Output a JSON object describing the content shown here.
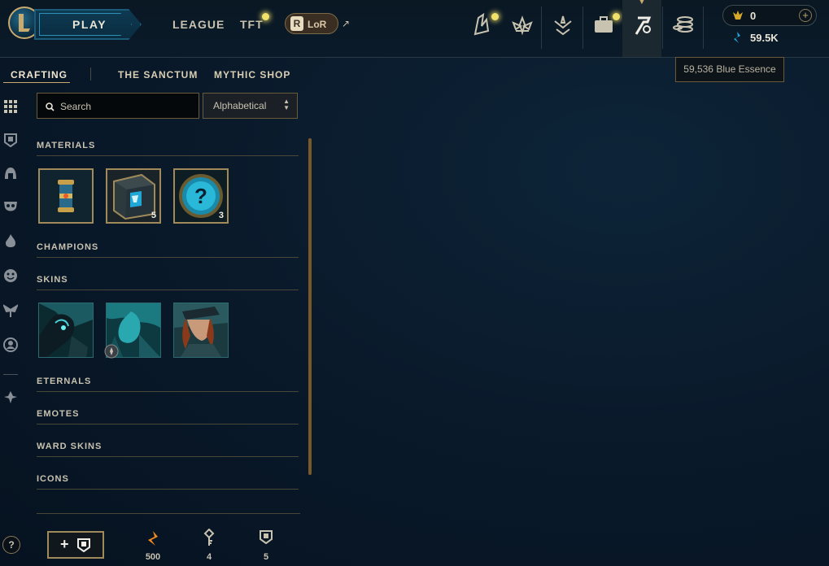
{
  "topbar": {
    "play_label": "PLAY",
    "nav": [
      "LEAGUE",
      "TFT"
    ],
    "lor_label": "LoR",
    "lor_badge": "R",
    "external_arrow": "↗",
    "hub_icons": [
      "collection-shards-icon",
      "clash-icon",
      "profile-honor-icon",
      "loot-bag-icon",
      "crafting-hammer-icon",
      "store-coins-icon"
    ],
    "rp_value": "0",
    "plus": "+",
    "be_value": "59.5K",
    "tooltip": "59,536 Blue Essence"
  },
  "subnav": {
    "tabs": [
      "CRAFTING",
      "THE SANCTUM",
      "MYTHIC SHOP"
    ],
    "active": "CRAFTING"
  },
  "toolbar": {
    "search_placeholder": "Search",
    "sort_label": "Alphabetical",
    "sort_chevron_up": "▲",
    "sort_chevron_down": "▼"
  },
  "sections": {
    "materials": "MATERIALS",
    "champions": "CHAMPIONS",
    "skins": "SKINS",
    "eternals": "ETERNALS",
    "emotes": "EMOTES",
    "ward_skins": "WARD SKINS",
    "icons": "ICONS"
  },
  "materials": [
    {
      "name": "capsule",
      "count": ""
    },
    {
      "name": "chest",
      "count": "5"
    },
    {
      "name": "mystery-orb",
      "count": "3"
    }
  ],
  "bottom": {
    "help": "?",
    "add": "+",
    "orange_essence": "500",
    "keys": "4",
    "chests": "5"
  },
  "colors": {
    "gold": "#c8aa6e",
    "accent_blue": "#1fa8d6",
    "orange_essence": "#f0891e",
    "background": "#0a1a2b"
  }
}
